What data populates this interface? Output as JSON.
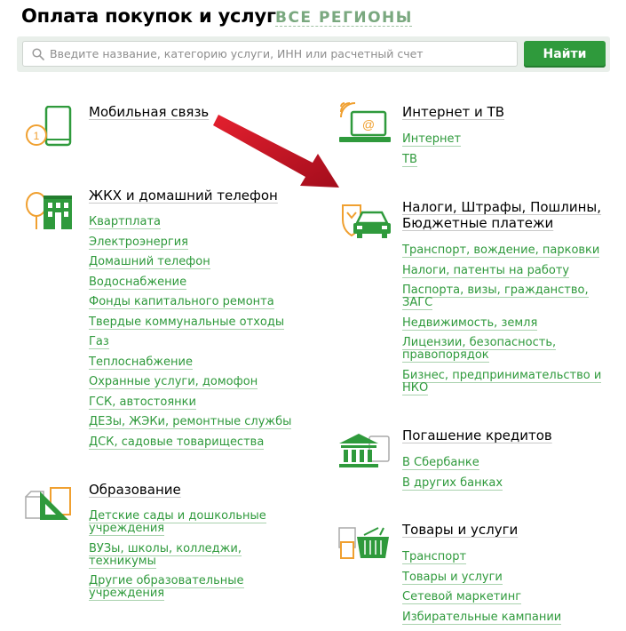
{
  "header": {
    "title": "Оплата покупок и услуг",
    "region_link": "все регионы"
  },
  "search": {
    "placeholder": "Введите название, категорию услуги, ИНН или расчетный счет",
    "value": "",
    "button_label": "Найти"
  },
  "colors": {
    "accent": "#2f9a3c",
    "link": "#2f9a3c",
    "icon_orange": "#f0a030",
    "arrow": "#c8102e"
  },
  "left_column": [
    {
      "title": "Мобильная связь",
      "icon": "mobile-phone-icon",
      "links": []
    },
    {
      "title": "ЖКХ и домашний телефон",
      "icon": "house-icon",
      "links": [
        "Квартплата",
        "Электроэнергия",
        "Домашний телефон",
        "Водоснабжение",
        "Фонды капитального ремонта",
        "Твердые коммунальные отходы",
        "Газ",
        "Теплоснабжение",
        "Охранные услуги, домофон",
        "ГСК, автостоянки",
        "ДЕЗы, ЖЭКи, ремонтные службы",
        "ДСК, садовые товарищества"
      ]
    },
    {
      "title": "Образование",
      "icon": "ruler-triangle-icon",
      "links": [
        "Детские сады и дошкольные учреждения",
        "ВУЗы, школы, колледжи, техникумы",
        "Другие образовательные учреждения"
      ]
    }
  ],
  "right_column": [
    {
      "title": "Интернет и ТВ",
      "icon": "laptop-wifi-icon",
      "links": [
        "Интернет",
        "ТВ"
      ]
    },
    {
      "title": "Налоги, Штрафы, Пошлины, Бюджетные платежи",
      "icon": "car-emblem-icon",
      "links": [
        "Транспорт, вождение, парковки",
        "Налоги, патенты на работу",
        "Паспорта, визы, гражданство, ЗАГС",
        "Недвижимость, земля",
        "Лицензии, безопасность, правопорядок",
        "Бизнес, предпринимательство и НКО"
      ]
    },
    {
      "title": "Погашение кредитов",
      "icon": "bank-building-icon",
      "links": [
        "В Сбербанке",
        "В других банках"
      ]
    },
    {
      "title": "Товары и услуги",
      "icon": "shopping-basket-icon",
      "links": [
        "Транспорт",
        "Товары и услуги",
        "Сетевой маркетинг",
        "Избирательные кампании"
      ]
    }
  ]
}
